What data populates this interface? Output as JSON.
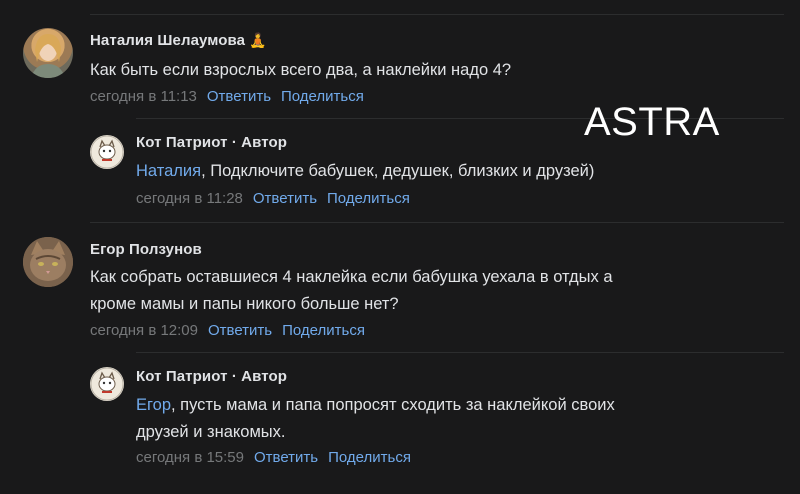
{
  "watermark": "ASTRA",
  "comments": [
    {
      "author": "Наталия Шелаумова",
      "emoji": "🧘",
      "text": "Как быть если взрослых всего два, а наклейки надо 4?",
      "time": "сегодня в 11:13",
      "reply_label": "Ответить",
      "share_label": "Поделиться"
    },
    {
      "author": "Кот Патриот · Автор",
      "mention": "Наталия",
      "text": ", Подключите бабушек, дедушек, близких и друзей)",
      "time": "сегодня в 11:28",
      "reply_label": "Ответить",
      "share_label": "Поделиться"
    },
    {
      "author": "Егор Ползунов",
      "text_line1": "Как собрать оставшиеся 4 наклейка если бабушка уехала в отдых а",
      "text_line2": "кроме мамы и папы никого больше нет?",
      "time": "сегодня в 12:09",
      "reply_label": "Ответить",
      "share_label": "Поделиться"
    },
    {
      "author": "Кот Патриот · Автор",
      "mention": "Егор",
      "text_line1": ", пусть мама и папа попросят сходить за наклейкой своих",
      "text_line2": "друзей и знакомых.",
      "time": "сегодня в 15:59",
      "reply_label": "Ответить",
      "share_label": "Поделиться"
    }
  ],
  "colors": {
    "background": "#19191a",
    "text": "#e1e3e6",
    "link": "#71aaeb",
    "muted": "#76787a",
    "divider": "#2c2d2e"
  }
}
